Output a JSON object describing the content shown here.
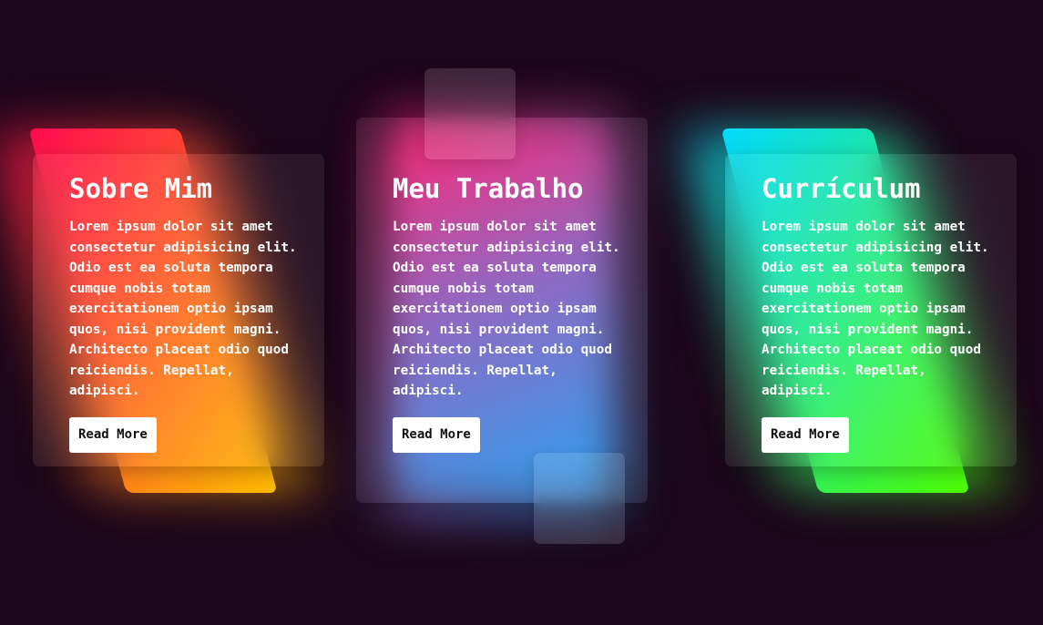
{
  "cards": [
    {
      "title": "Sobre Mim",
      "text": "Lorem ipsum dolor sit amet consectetur adipisicing elit. Odio est ea soluta tempora cumque nobis totam exercitationem optio ipsam quos, nisi provident magni. Architecto placeat odio quod reiciendis. Repellat, adipisci.",
      "button_label": "Read More",
      "gradient_start": "#ff0a4f",
      "gradient_end": "#ffbc00"
    },
    {
      "title": "Meu Trabalho",
      "text": "Lorem ipsum dolor sit amet consectetur adipisicing elit. Odio est ea soluta tempora cumque nobis totam exercitationem optio ipsam quos, nisi provident magni. Architecto placeat odio quod reiciendis. Repellat, adipisci.",
      "button_label": "Read More",
      "gradient_start": "#ff1a6e",
      "gradient_end": "#1e9bf0"
    },
    {
      "title": "Currículum",
      "text": "Lorem ipsum dolor sit amet consectetur adipisicing elit. Odio est ea soluta tempora cumque nobis totam exercitationem optio ipsam quos, nisi provident magni. Architecto placeat odio quod reiciendis. Repellat, adipisci.",
      "button_label": "Read More",
      "gradient_start": "#03d9ff",
      "gradient_end": "#4dff03"
    }
  ],
  "colors": {
    "background": "#1c0619",
    "button_bg": "#ffffff",
    "button_text": "#111111"
  }
}
